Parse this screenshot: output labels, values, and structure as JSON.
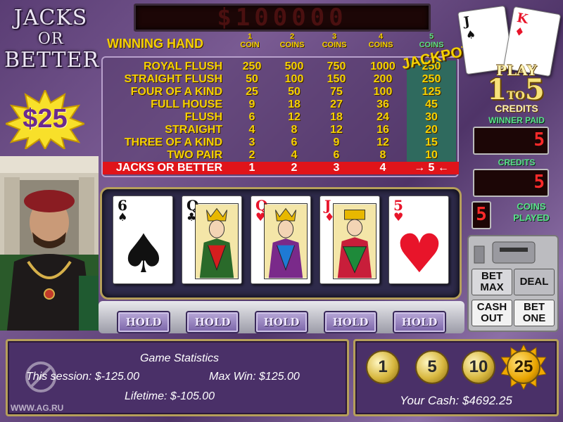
{
  "title": {
    "line1": "JACKS",
    "line2": "OR",
    "line3": "BETTER"
  },
  "bet_denomination": "$25",
  "top_display": "$100000",
  "paytable": {
    "header": "WINNING HAND",
    "columns": [
      {
        "num": "1",
        "label": "COIN"
      },
      {
        "num": "2",
        "label": "COINS"
      },
      {
        "num": "3",
        "label": "COINS"
      },
      {
        "num": "4",
        "label": "COINS"
      },
      {
        "num": "5",
        "label": "COINS"
      }
    ],
    "jackpot_label": "JACKPOT",
    "rows": [
      {
        "hand": "ROYAL FLUSH",
        "pays": [
          "250",
          "500",
          "750",
          "1000",
          "250"
        ]
      },
      {
        "hand": "STRAIGHT FLUSH",
        "pays": [
          "50",
          "100",
          "150",
          "200",
          "250"
        ]
      },
      {
        "hand": "FOUR OF A KIND",
        "pays": [
          "25",
          "50",
          "75",
          "100",
          "125"
        ]
      },
      {
        "hand": "FULL HOUSE",
        "pays": [
          "9",
          "18",
          "27",
          "36",
          "45"
        ]
      },
      {
        "hand": "FLUSH",
        "pays": [
          "6",
          "12",
          "18",
          "24",
          "30"
        ]
      },
      {
        "hand": "STRAIGHT",
        "pays": [
          "4",
          "8",
          "12",
          "16",
          "20"
        ]
      },
      {
        "hand": "THREE OF A KIND",
        "pays": [
          "3",
          "6",
          "9",
          "12",
          "15"
        ]
      },
      {
        "hand": "TWO PAIR",
        "pays": [
          "2",
          "4",
          "6",
          "8",
          "10"
        ]
      },
      {
        "hand": "JACKS OR BETTER",
        "pays": [
          "1",
          "2",
          "3",
          "4",
          "→ 5 ←"
        ]
      }
    ],
    "highlighted_row": 8
  },
  "play_info": {
    "play": "PLAY",
    "from": "1",
    "to_word": "TO",
    "to": "5",
    "credits": "CREDITS"
  },
  "winner_paid": {
    "label": "WINNER PAID",
    "value": "5"
  },
  "credits": {
    "label": "CREDITS",
    "value": "5"
  },
  "coins_played": {
    "value": "5",
    "label_line1": "COINS",
    "label_line2": "PLAYED"
  },
  "cards": [
    {
      "rank": "6",
      "suit": "♠",
      "color": "black",
      "face": false
    },
    {
      "rank": "Q",
      "suit": "♣",
      "color": "black",
      "face": true
    },
    {
      "rank": "Q",
      "suit": "♥",
      "color": "red",
      "face": true
    },
    {
      "rank": "J",
      "suit": "♦",
      "color": "red",
      "face": true
    },
    {
      "rank": "5",
      "suit": "♥",
      "color": "red",
      "face": false
    }
  ],
  "hold_label": "HOLD",
  "controls": {
    "bet_max": [
      "BET",
      "MAX"
    ],
    "deal": "DEAL",
    "cash_out": [
      "CASH",
      "OUT"
    ],
    "bet_one": [
      "BET",
      "ONE"
    ]
  },
  "stats": {
    "title": "Game Statistics",
    "session": "This session: $-125.00",
    "max_win": "Max Win: $125.00",
    "lifetime": "Lifetime: $-105.00"
  },
  "watermark": "WWW.AG.RU",
  "coin_denominations": [
    "1",
    "5",
    "10",
    "25"
  ],
  "active_denomination": "25",
  "your_cash": "Your Cash: $4692.25",
  "decor_cards": [
    {
      "rank": "J",
      "suit": "♠"
    },
    {
      "rank": "K",
      "suit": "♦"
    }
  ]
}
